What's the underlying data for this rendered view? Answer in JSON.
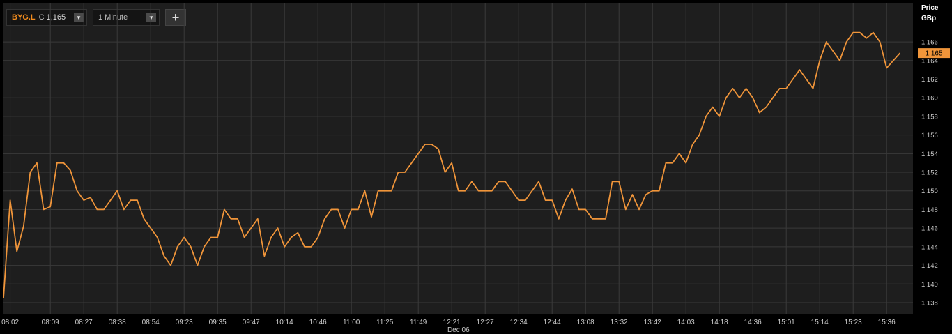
{
  "toolbar": {
    "symbol": "BYG.L",
    "close_prefix": "C",
    "close_value": "1,165",
    "timeframe": "1 Minute",
    "add_label": "+",
    "dropdown_glyph": "▼"
  },
  "colors": {
    "line": "#f0953a",
    "grid": "#3a3a3a",
    "plot_bg": "#1e1e1e",
    "badge": "#f0953a"
  },
  "chart_data": {
    "type": "line",
    "axis_title": [
      "Price",
      "GBp"
    ],
    "ylim": [
      1136.8,
      1170.2
    ],
    "yticks": [
      1138,
      1140,
      1142,
      1144,
      1146,
      1148,
      1150,
      1152,
      1154,
      1156,
      1158,
      1160,
      1162,
      1164,
      1166
    ],
    "ytick_labels": [
      "1,138",
      "1,140",
      "1,142",
      "1,144",
      "1,146",
      "1,148",
      "1,150",
      "1,152",
      "1,154",
      "1,156",
      "1,158",
      "1,160",
      "1,162",
      "1,164",
      "1,166"
    ],
    "xlim": [
      0,
      131
    ],
    "x_ticks": [
      {
        "i": 1,
        "label": "08:02"
      },
      {
        "i": 7,
        "label": "08:09"
      },
      {
        "i": 12,
        "label": "08:27"
      },
      {
        "i": 17,
        "label": "08:38"
      },
      {
        "i": 22,
        "label": "08:54"
      },
      {
        "i": 27,
        "label": "09:23"
      },
      {
        "i": 32,
        "label": "09:35"
      },
      {
        "i": 37,
        "label": "09:47"
      },
      {
        "i": 42,
        "label": "10:14"
      },
      {
        "i": 47,
        "label": "10:46"
      },
      {
        "i": 52,
        "label": "11:00"
      },
      {
        "i": 57,
        "label": "11:25"
      },
      {
        "i": 62,
        "label": "11:49"
      },
      {
        "i": 67,
        "label": "12:21"
      },
      {
        "i": 72,
        "label": "12:27"
      },
      {
        "i": 77,
        "label": "12:34"
      },
      {
        "i": 82,
        "label": "12:44"
      },
      {
        "i": 87,
        "label": "13:08"
      },
      {
        "i": 92,
        "label": "13:32"
      },
      {
        "i": 97,
        "label": "13:42"
      },
      {
        "i": 102,
        "label": "14:03"
      },
      {
        "i": 107,
        "label": "14:18"
      },
      {
        "i": 112,
        "label": "14:36"
      },
      {
        "i": 117,
        "label": "15:01"
      },
      {
        "i": 122,
        "label": "15:14"
      },
      {
        "i": 127,
        "label": "15:23"
      },
      {
        "i": 132,
        "label": "15:36"
      }
    ],
    "date_label": "Dec 06",
    "date_at": 68,
    "last_value": 1164.8,
    "last_label": "1,165",
    "grid": true,
    "series": [
      {
        "values": [
          1138.5,
          1149,
          1143.5,
          1146.2,
          1152,
          1153,
          1148,
          1148.3,
          1153,
          1153,
          1152.2,
          1150,
          1149,
          1149.3,
          1148,
          1148,
          1149,
          1150,
          1148,
          1149,
          1149,
          1147,
          1146,
          1145,
          1143,
          1142,
          1144,
          1145,
          1144,
          1142,
          1144,
          1145,
          1145,
          1148,
          1147,
          1147,
          1145,
          1146,
          1147,
          1143,
          1145,
          1146,
          1144,
          1145,
          1145.5,
          1144,
          1144,
          1145,
          1147,
          1148,
          1148,
          1146,
          1148,
          1148,
          1150,
          1147.2,
          1150,
          1150,
          1150,
          1152,
          1152,
          1153,
          1154,
          1155,
          1155,
          1154.5,
          1152,
          1153,
          1150,
          1150,
          1151,
          1150,
          1150,
          1150,
          1151,
          1151,
          1150,
          1149,
          1149,
          1150,
          1151,
          1149,
          1149,
          1147,
          1149,
          1150.2,
          1148,
          1148,
          1147,
          1147,
          1147,
          1151,
          1151,
          1148,
          1149.6,
          1148,
          1149.6,
          1150,
          1150,
          1153,
          1153,
          1154,
          1153,
          1155,
          1156,
          1158,
          1159,
          1158,
          1160,
          1161,
          1160,
          1161,
          1160,
          1158.4,
          1159,
          1160,
          1161,
          1161,
          1162,
          1163,
          1162,
          1161,
          1164,
          1166,
          1165,
          1164,
          1166,
          1167,
          1167,
          1166.4,
          1167,
          1166,
          1163.2,
          1164,
          1164.8
        ]
      }
    ]
  }
}
